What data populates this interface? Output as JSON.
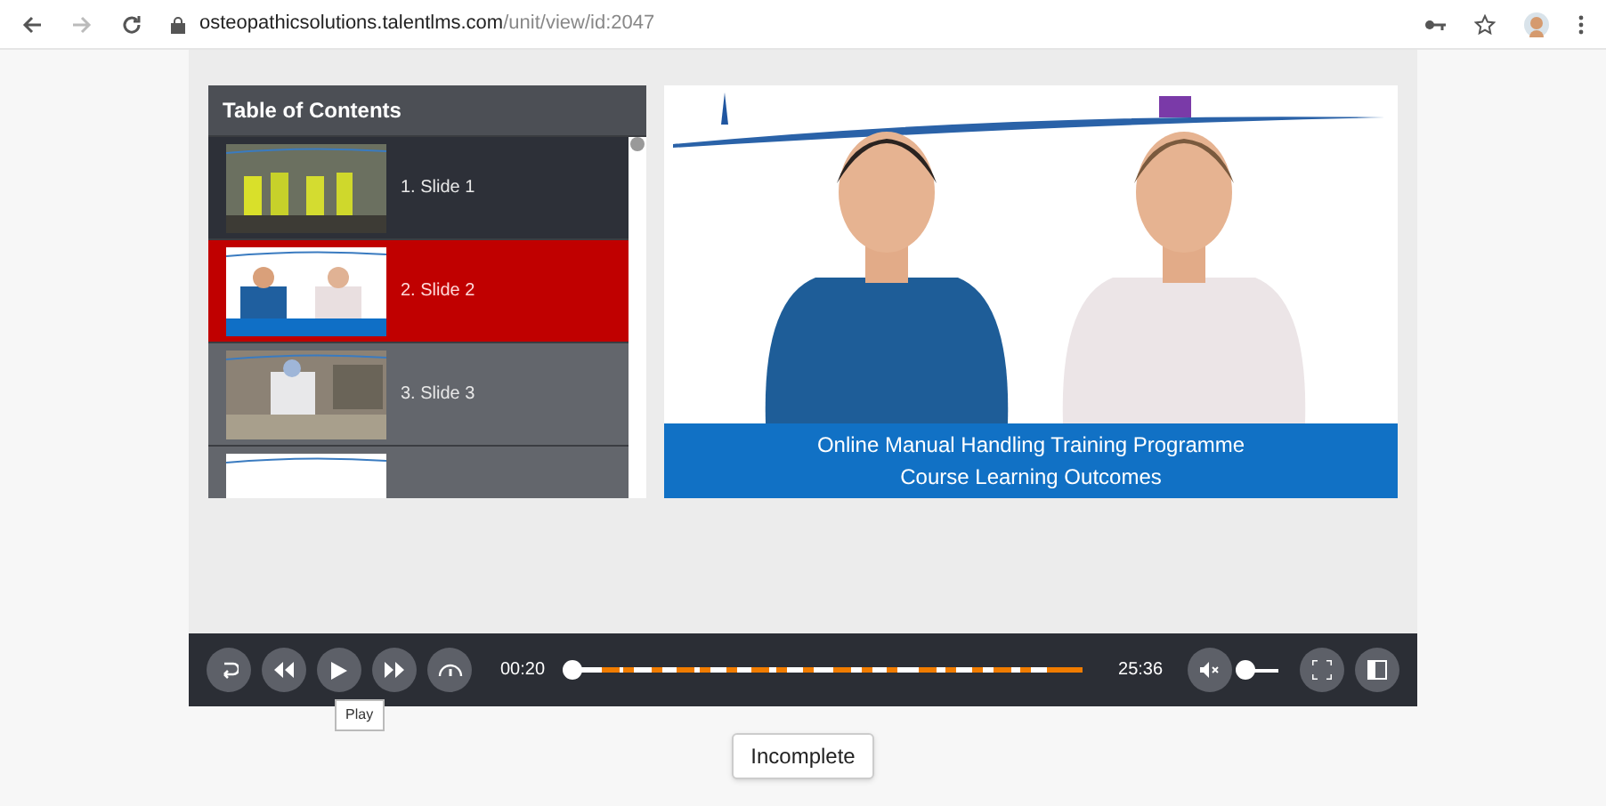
{
  "browser": {
    "url_host": "osteopathicsolutions.talentlms.com",
    "url_path": "/unit/view/id:2047"
  },
  "toc": {
    "title": "Table of Contents",
    "items": [
      {
        "label": "1. Slide 1",
        "selected": false
      },
      {
        "label": "2. Slide 2",
        "selected": true
      },
      {
        "label": "3. Slide 3",
        "selected": false
      },
      {
        "selected": false
      }
    ]
  },
  "slide": {
    "caption_lines": [
      "Online Manual Handling Training Programme",
      "Course Learning Outcomes"
    ]
  },
  "player": {
    "current_time": "00:20",
    "total_time": "25:36",
    "seek": {
      "level": 0.01
    },
    "volume": {
      "level": 0.05
    },
    "tooltip": "Play"
  },
  "status_button": "Incomplete"
}
